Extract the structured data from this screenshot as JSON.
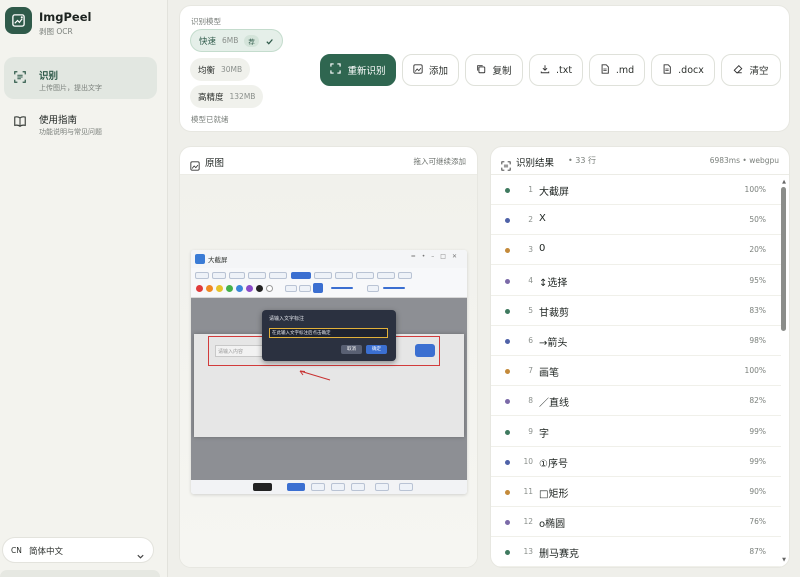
{
  "app": {
    "name": "ImgPeel",
    "subtitle": "剥图 OCR"
  },
  "nav": [
    {
      "title": "识别",
      "subtitle": "上传图片，提出文字",
      "icon": "scan-text-icon",
      "active": true
    },
    {
      "title": "使用指南",
      "subtitle": "功能说明与常见问题",
      "icon": "book-icon",
      "active": false
    }
  ],
  "language": {
    "code": "CN",
    "label": "简体中文"
  },
  "models": {
    "label": "识别模型",
    "options": [
      {
        "name": "快速",
        "size": "6MB",
        "badge": "荐",
        "selected": true
      },
      {
        "name": "均衡",
        "size": "30MB",
        "selected": false
      },
      {
        "name": "高精度",
        "size": "132MB",
        "selected": false
      }
    ],
    "status": "模型已就绪"
  },
  "toolbar": {
    "recognize": "重新识别",
    "add": "添加",
    "copy": "复制",
    "txt": ".txt",
    "md": ".md",
    "docx": ".docx",
    "clear": "清空"
  },
  "source": {
    "title": "原图",
    "hint": "拖入可继续添加"
  },
  "preview": {
    "window_title": "大截屏",
    "dialog_title": "请输入文字标注",
    "dialog_input": "在此输入文字标注后点击确定",
    "dialog_cancel": "取消",
    "dialog_ok": "确定",
    "input_placeholder": "请输入内容"
  },
  "results": {
    "title": "识别结果",
    "count": "• 33 行",
    "meta": "6983ms • webgpu",
    "colors": {
      "green": "#3f7a5f",
      "blue": "#4f62a8",
      "orange": "#c48a3a",
      "purple": "#7b6aa8"
    },
    "rows": [
      {
        "idx": "1",
        "text": "大截屏",
        "conf": "100%",
        "dot": "green"
      },
      {
        "idx": "2",
        "text": "X",
        "conf": "50%",
        "dot": "blue"
      },
      {
        "idx": "3",
        "text": "0",
        "conf": "20%",
        "dot": "orange"
      },
      {
        "idx": "4",
        "text": "↕选择",
        "conf": "95%",
        "dot": "purple"
      },
      {
        "idx": "5",
        "text": "甘裁剪",
        "conf": "83%",
        "dot": "green"
      },
      {
        "idx": "6",
        "text": "→箭头",
        "conf": "98%",
        "dot": "blue"
      },
      {
        "idx": "7",
        "text": "画笔",
        "conf": "100%",
        "dot": "orange"
      },
      {
        "idx": "8",
        "text": "／直线",
        "conf": "82%",
        "dot": "purple"
      },
      {
        "idx": "9",
        "text": "字",
        "conf": "99%",
        "dot": "green"
      },
      {
        "idx": "10",
        "text": "①序号",
        "conf": "99%",
        "dot": "blue"
      },
      {
        "idx": "11",
        "text": "□矩形",
        "conf": "90%",
        "dot": "orange"
      },
      {
        "idx": "12",
        "text": "o椭圆",
        "conf": "76%",
        "dot": "purple"
      },
      {
        "idx": "13",
        "text": "删马赛克",
        "conf": "87%",
        "dot": "green"
      }
    ]
  }
}
